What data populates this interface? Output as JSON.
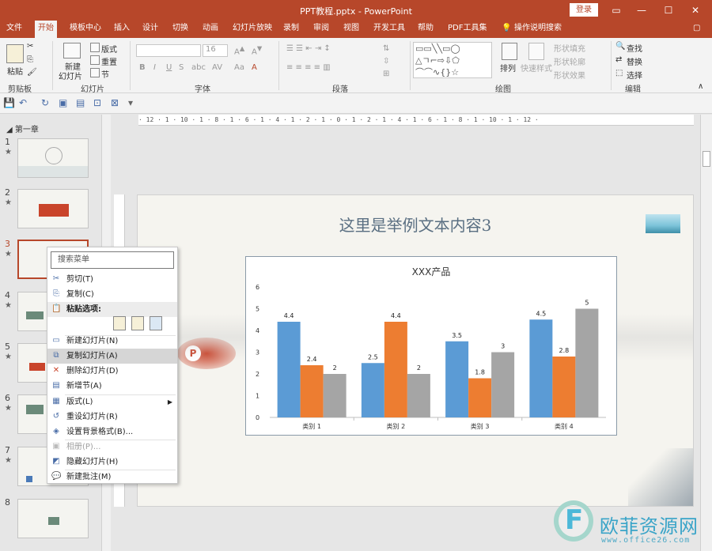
{
  "window": {
    "title": "PPT教程.pptx  -  PowerPoint",
    "login_label": "登录",
    "ctrl_ribbon": "▭",
    "ctrl_min": "—",
    "ctrl_max": "☐",
    "ctrl_close": "✕"
  },
  "tabs": [
    "文件",
    "开始",
    "模板中心",
    "插入",
    "设计",
    "切换",
    "动画",
    "幻灯片放映",
    "录制",
    "审阅",
    "视图",
    "开发工具",
    "帮助",
    "PDF工具集",
    "操作说明搜索"
  ],
  "ribbon": {
    "clipboard": {
      "paste": "粘贴",
      "label": "剪贴板"
    },
    "slides": {
      "new_slide_line1": "新建",
      "new_slide_line2": "幻灯片",
      "layout": "版式",
      "reset": "重置",
      "section": "节",
      "label": "幻灯片"
    },
    "font": {
      "size": "16",
      "label": "字体"
    },
    "paragraph": {
      "label": "段落"
    },
    "drawing": {
      "arrange": "排列",
      "quick_styles": "快速样式",
      "shape_fill": "形状填充",
      "shape_outline": "形状轮廓",
      "shape_effects": "形状效果",
      "label": "绘图"
    },
    "editing": {
      "find": "查找",
      "replace": "替换",
      "select": "选择",
      "label": "编辑"
    }
  },
  "thumbnails": {
    "section": "第一章",
    "items": [
      {
        "num": "1",
        "star": "★"
      },
      {
        "num": "2",
        "star": "★"
      },
      {
        "num": "3",
        "star": "★"
      },
      {
        "num": "4",
        "star": "★"
      },
      {
        "num": "5",
        "star": "★"
      },
      {
        "num": "6",
        "star": "★"
      },
      {
        "num": "7",
        "star": "★"
      },
      {
        "num": "8",
        "star": ""
      }
    ]
  },
  "ruler": {
    "horizontal": "· 12 · 1 · 10 · 1 · 8 · 1 · 6 · 1 · 4 · 1 · 2 · 1 · 0 · 1 · 2 · 1 · 4 · 1 · 6 · 1 · 8 · 1 · 10 · 1 · 12 ·"
  },
  "slide": {
    "title": "这里是举例文本内容3"
  },
  "context_menu": {
    "search_placeholder": "搜索菜单",
    "cut": "剪切(T)",
    "copy": "复制(C)",
    "paste_options": "粘贴选项:",
    "new_slide": "新建幻灯片(N)",
    "duplicate_slide": "复制幻灯片(A)",
    "delete_slide": "删除幻灯片(D)",
    "new_section": "新增节(A)",
    "layout": "版式(L)",
    "reset_slide": "重设幻灯片(R)",
    "format_background": "设置背景格式(B)...",
    "album": "相册(P)...",
    "hide_slide": "隐藏幻灯片(H)",
    "new_comment": "新建批注(M)"
  },
  "chart_data": {
    "type": "bar",
    "title": "XXX产品",
    "categories": [
      "类别 1",
      "类别 2",
      "类别 3",
      "类别 4"
    ],
    "series": [
      {
        "values": [
          4.4,
          2.5,
          3.5,
          4.5
        ],
        "color": "#5b9bd5"
      },
      {
        "values": [
          2.4,
          4.4,
          1.8,
          2.8
        ],
        "color": "#ed7d31"
      },
      {
        "values": [
          2,
          2,
          3,
          5
        ],
        "color": "#a5a5a5"
      }
    ],
    "ylim": [
      0,
      6
    ],
    "yticks": [
      0,
      1,
      2,
      3,
      4,
      5,
      6
    ],
    "grid": false,
    "legend": "none"
  },
  "watermark": {
    "letter": "F",
    "name": "欧菲资源网",
    "url": "www.office26.com"
  },
  "colors": {
    "brand": "#b7472a",
    "series1": "#5b9bd5",
    "series2": "#ed7d31",
    "series3": "#a5a5a5"
  }
}
